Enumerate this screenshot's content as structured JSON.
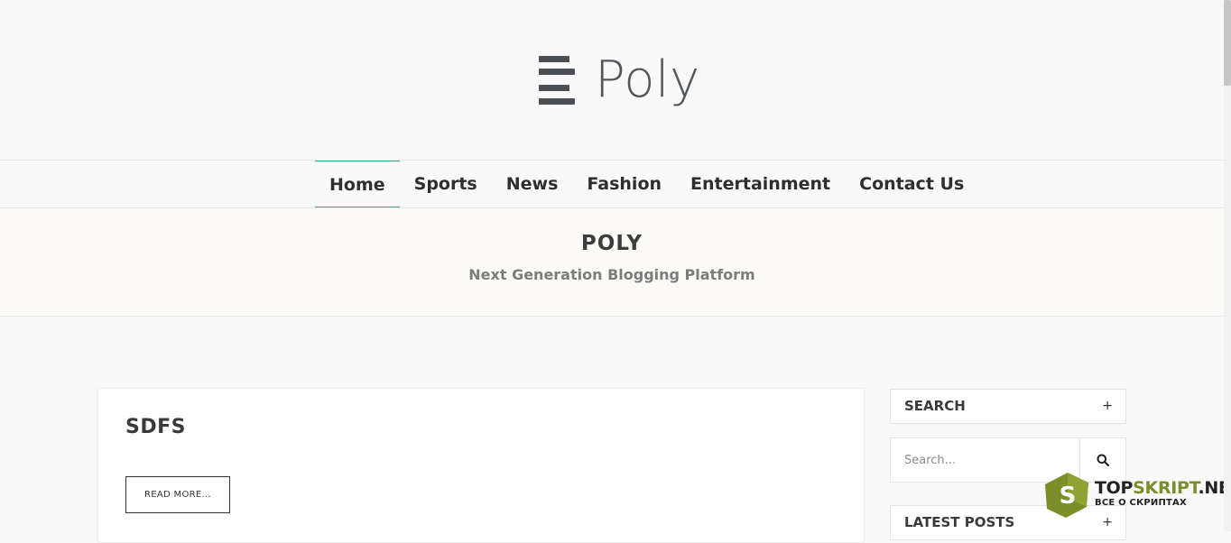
{
  "brand": {
    "name": "Poly",
    "icon": "menu-lines-icon"
  },
  "nav": {
    "items": [
      {
        "label": "Home",
        "active": true
      },
      {
        "label": "Sports"
      },
      {
        "label": "News"
      },
      {
        "label": "Fashion"
      },
      {
        "label": "Entertainment"
      },
      {
        "label": "Contact Us"
      }
    ]
  },
  "hero": {
    "title": "POLY",
    "subtitle": "Next Generation Blogging Platform"
  },
  "post": {
    "title": "SDFS",
    "read_more": "READ MORE..."
  },
  "sidebar": {
    "search": {
      "title": "SEARCH",
      "toggle": "+",
      "placeholder": "Search...",
      "button_icon": "search-icon"
    },
    "latest": {
      "title": "LATEST POSTS",
      "toggle": "+"
    }
  },
  "watermark": {
    "part1": "TOP",
    "part2": "SKRIPT",
    "part3": ".NET",
    "tagline": "ВСЕ О СКРИПТАХ",
    "letter": "S"
  },
  "colors": {
    "accent": "#3aaa80",
    "logo": "#4a4f55",
    "watermark_green": "#7a8e2a"
  }
}
